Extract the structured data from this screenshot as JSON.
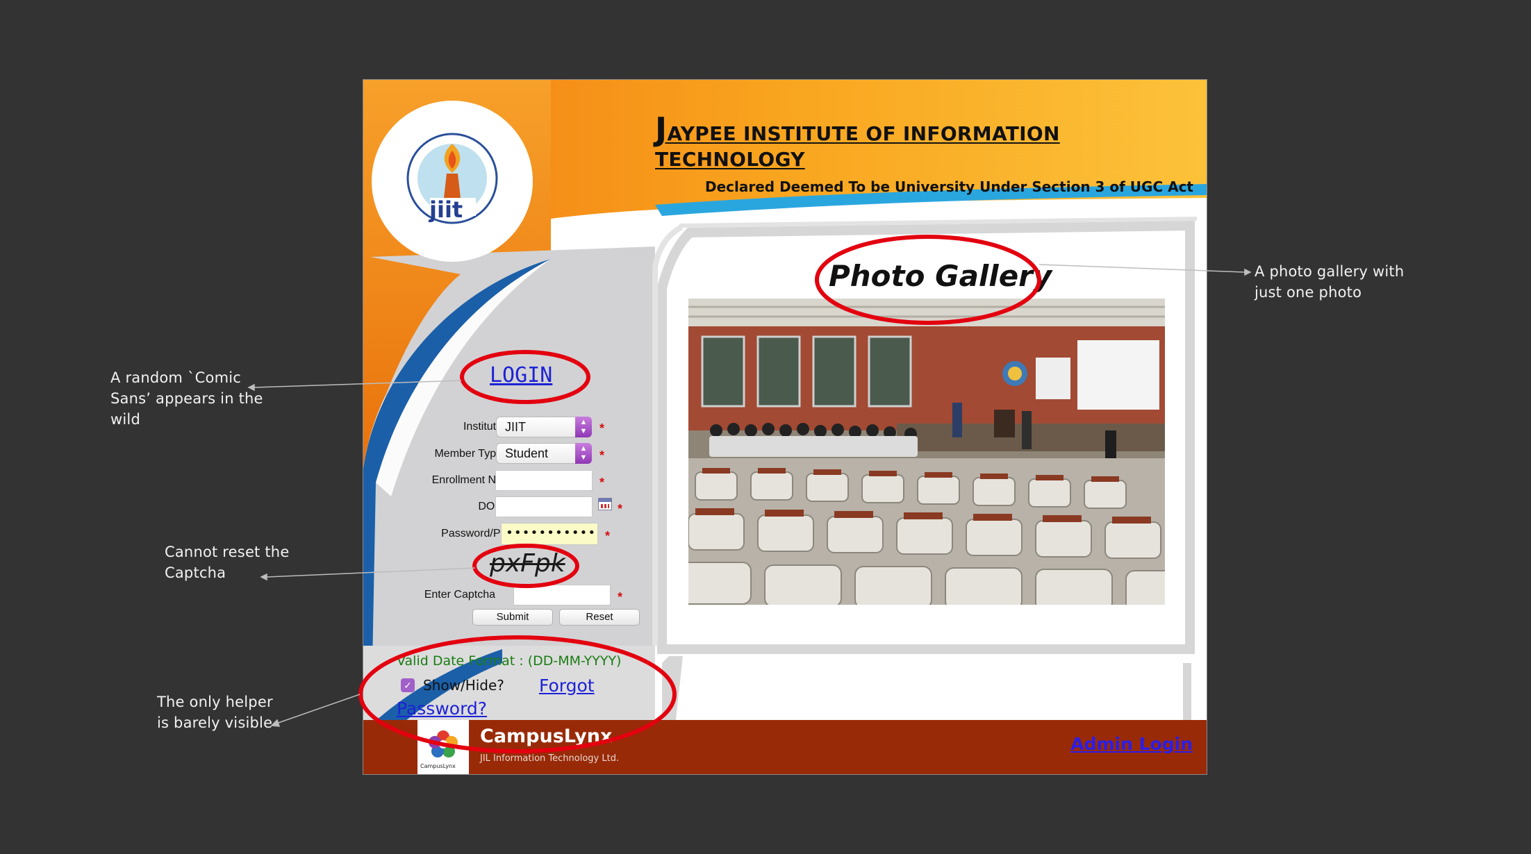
{
  "site": {
    "title_first_letter": "J",
    "title_rest": "AYPEE INSTITUTE OF INFORMATION TECHNOLOGY",
    "subtitle": "Declared Deemed To be University Under Section 3 of UGC Act",
    "logo_text": "jiit"
  },
  "gallery": {
    "title": "Photo Gallery",
    "photo": "lecture-hall-photo"
  },
  "login": {
    "heading": "LOGIN",
    "institute_label": "Institute",
    "institute_value": "JIIT",
    "member_type_label": "Member Type",
    "member_type_value": "Student",
    "enrollment_label": "Enrollment No",
    "enrollment_value": "",
    "dob_label": "DOB",
    "dob_value": "",
    "password_label": "Password/Pin",
    "password_value": "••••••••••••••••",
    "captcha_text": "pxFpk",
    "enter_captcha_label": "Enter Captcha",
    "enter_captcha_value": "",
    "required_mark": "*",
    "submit_label": "Submit",
    "reset_label": "Reset",
    "date_format_hint": "Valid Date Format : (DD-MM-YYYY)",
    "show_hide_label": "Show/Hide?",
    "show_hide_checked": true,
    "forgot_password": "Forgot Password?"
  },
  "footer": {
    "brand_name": "CampusLynx",
    "brand_tagline": "JIL Information Technology Ltd.",
    "brand_logo_text": "CampusLynx",
    "admin_login": "Admin Login"
  },
  "annotations": {
    "gallery_note": "A photo gallery with just one photo",
    "font_note": "A random `Comic Sans’ appears in the wild",
    "captcha_note": "Cannot reset the Captcha",
    "helper_note": "The only helper is barely visible"
  },
  "colors": {
    "slide_bg": "#333333",
    "highlight_red": "#e3000f",
    "header_orange": "#f6921e",
    "footer_red": "#992a08",
    "link_blue": "#1d22d6",
    "hint_green": "#1a7d12"
  }
}
